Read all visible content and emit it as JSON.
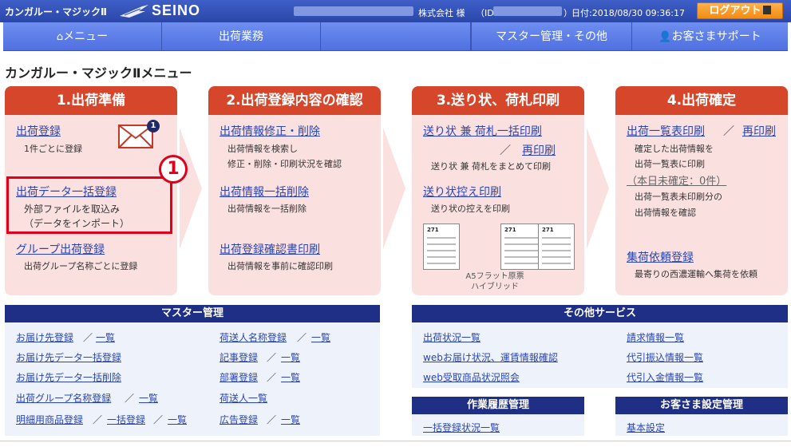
{
  "topbar": {
    "app_name": "カンガルー・マジックⅡ",
    "brand": "SEINO",
    "company_suffix": "株式会社 様",
    "id_label": "（ID",
    "id_close": "）",
    "date_text": "日付:2018/08/30 09:36:17",
    "logout_label": "ログアウト"
  },
  "nav": {
    "menu": "メニュー",
    "shipping": "出荷業務",
    "master": "マスター管理・その他",
    "support": "お客さまサポート"
  },
  "page_title": "カンガルー・マジックⅡメニュー",
  "step1": {
    "title": "1.出荷準備",
    "reg_link": "出荷登録",
    "reg_desc": "1件ごとに登録",
    "badge": "1",
    "bulk_link": "出荷データ一括登録",
    "bulk_desc1": "外部ファイルを取込み",
    "bulk_desc2": "（データをインポート）",
    "marker": "1",
    "group_link": "グループ出荷登録",
    "group_desc": "出荷グループ名称ごとに登録"
  },
  "step2": {
    "title": "2.出荷登録内容の確認",
    "edit_link": "出荷情報修正・削除",
    "edit_desc1": "出荷情報を検索し",
    "edit_desc2": "修正・削除・印刷状況を確認",
    "bulkdel_link": "出荷情報一括削除",
    "bulkdel_desc": "出荷情報を一括削除",
    "confirm_link": "出荷登録確認書印刷",
    "confirm_desc": "出荷情報を事前に確認印刷"
  },
  "step3": {
    "title": "3.送り状、荷札印刷",
    "print_link": "送り状 兼 荷札一括印刷",
    "slash": "／",
    "reprint_link": "再印刷",
    "print_desc": "送り状 兼 荷札をまとめて印刷",
    "copy_link": "送り状控え印刷",
    "copy_desc": "送り状の控えを印刷",
    "thumb_num1": "271",
    "thumb_num2": "271",
    "thumb_num3": "271",
    "caption1": "A5フラット原票",
    "caption2": "ハイブリッド"
  },
  "step4": {
    "title": "4.出荷確定",
    "list_link": "出荷一覧表印刷",
    "slash": "／",
    "reprint_link": "再印刷",
    "list_desc1": "確定した出荷情報を",
    "list_desc2": "出荷一覧表に印刷",
    "unconfirmed": "（本日未確定：0件）",
    "unprinted1": "出荷一覧表未印刷分の",
    "unprinted2": "出荷情報を確認",
    "pickup_link": "集荷依頼登録",
    "pickup_desc": "最寄りの西濃運輸へ集荷を依頼"
  },
  "master": {
    "title": "マスター管理",
    "slash": "／",
    "dest_reg": "お届け先登録",
    "list": "一覧",
    "dest_bulk": "お届け先データ一括登録",
    "dest_bulk_del": "お届け先データ一括削除",
    "group_name": "出荷グループ名称登録",
    "detail_item": "明細用商品登録",
    "bulk_reg": "一括登録",
    "shipper_name": "荷送人名称登録",
    "article": "記事登録",
    "dept": "部署登録",
    "shipper_list": "荷送人一覧",
    "ad": "広告登録"
  },
  "other": {
    "title": "その他サービス",
    "status": "出荷状況一覧",
    "web_dest": "webお届け状況、運賃情報確認",
    "web_receipt": "web受取商品状況照会",
    "billing": "請求情報一覧",
    "cod_transfer": "代引振込情報一覧",
    "cod_deposit": "代引入金情報一覧"
  },
  "history": {
    "title": "作業履歴管理",
    "bulk_status": "一括登録状況一覧"
  },
  "settings": {
    "title": "お客さま設定管理",
    "basic": "基本設定"
  },
  "colors": {
    "header_blue": "#2a46a8",
    "nav_blue": "#5b7ce6",
    "step_red": "#d5462a",
    "panel_pink": "#fbe0e0",
    "section_navy": "#1f2f86",
    "link_blue": "#2a45b3",
    "logout_orange": "#f28a12",
    "marker_red": "#e0001b"
  }
}
